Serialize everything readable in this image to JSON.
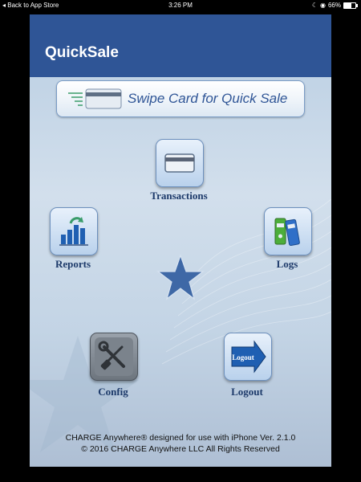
{
  "status_bar": {
    "back_text": "Back to App Store",
    "time": "3:26 PM",
    "battery": "66%"
  },
  "app": {
    "title": "QuickSale",
    "swipe_label": "Swipe Card for Quick Sale",
    "buttons": {
      "transactions": "Transactions",
      "reports": "Reports",
      "logs": "Logs",
      "config": "Config",
      "logout": "Logout",
      "logout_icon_text": "Logout"
    },
    "footer": {
      "line1": "CHARGE Anywhere® designed for use with iPhone Ver. 2.1.0",
      "line2": "© 2016 CHARGE Anywhere LLC All Rights Reserved"
    }
  },
  "icons": {
    "transactions": "credit-card-icon",
    "reports": "bar-chart-icon",
    "logs": "binders-icon",
    "config": "tools-icon",
    "logout": "arrow-right-icon",
    "center": "star-icon"
  },
  "colors": {
    "titlebar": "#2f5596",
    "accent": "#2f5596",
    "label": "#1d3a6a"
  }
}
